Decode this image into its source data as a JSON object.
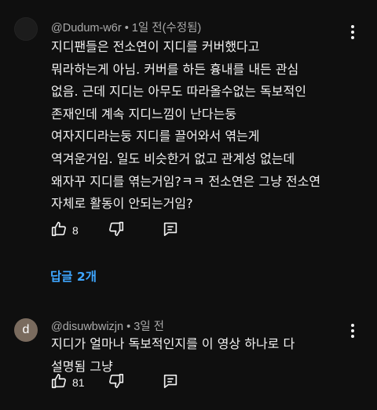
{
  "comment1": {
    "author": "@Dudum-w6r",
    "separator": "•",
    "time": "1일 전(수정됨)",
    "lines": [
      "지디팬들은 전소연이 지디를 커버했다고",
      "뭐라하는게 아님. 커버를 하든 흉내를 내든 관심",
      "없음. 근데 지디는 아무도 따라올수없는 독보적인",
      "존재인데 계속 지디느낌이 난다는둥",
      "여자지디라는둥 지디를 끌어와서 엮는게",
      "역겨운거임. 일도 비슷한거 없고 관계성 없는데",
      "왜자꾸 지디를 엮는거임?ㅋㅋ 전소연은 그냥 전소연",
      "자체로 활동이 안되는거임?"
    ],
    "like_count": "8",
    "replies_label": "답글 2개"
  },
  "comment2": {
    "avatar_letter": "d",
    "author": "@disuwbwizjn",
    "separator": "•",
    "time": "3일 전",
    "lines": [
      "지디가 얼마나 독보적인지를 이 영상 하나로 다",
      "설명됨 그냥"
    ],
    "like_count": "81"
  },
  "icons": {
    "like": "thumb-up-icon",
    "dislike": "thumb-down-icon",
    "reply": "reply-comment-icon",
    "more": "more-vert-icon"
  },
  "colors": {
    "background": "#0f0f0f",
    "text": "#f1f1f1",
    "meta": "#aaaaaa",
    "link": "#3ea6ff",
    "avatar2": "#7a6b5e"
  }
}
